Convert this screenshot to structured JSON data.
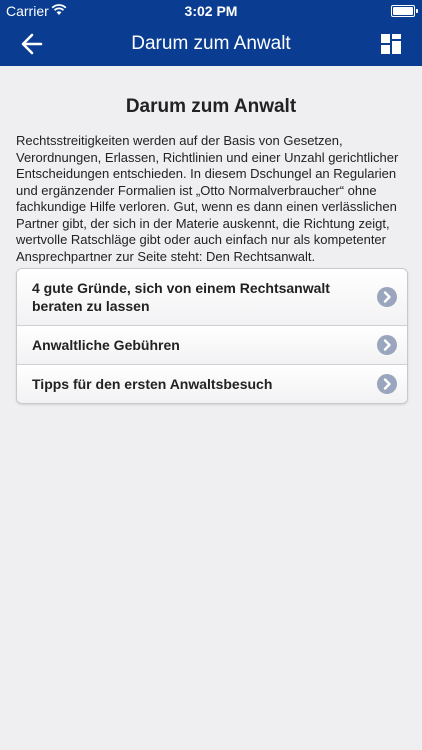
{
  "status": {
    "carrier": "Carrier",
    "time": "3:02 PM"
  },
  "nav": {
    "title": "Darum zum Anwalt"
  },
  "page": {
    "title": "Darum zum Anwalt",
    "intro": "Rechtsstreitigkeiten werden auf der Basis von Gesetzen, Verordnungen, Erlassen, Richtlinien und einer Unzahl gerichtlicher Entscheidungen entschieden. In diesem Dschungel an Regularien und ergänzender Formalien ist „Otto Normalverbraucher“ ohne fachkundige Hilfe verloren. Gut, wenn es dann einen verlässlichen Partner gibt, der sich in der Materie auskennt, die Richtung zeigt, wertvolle Ratschläge gibt oder auch einfach nur als kompetenter Ansprechpartner zur Seite steht: Den Rechtsanwalt."
  },
  "menu": {
    "items": [
      {
        "label": "4 gute Gründe, sich von einem Rechtsanwalt beraten zu lassen"
      },
      {
        "label": "Anwaltliche Gebühren"
      },
      {
        "label": "Tipps für den ersten Anwaltsbesuch"
      }
    ]
  },
  "colors": {
    "header": "#0a3d91",
    "background": "#efeff2",
    "chevron": "#9aa6bd"
  },
  "icons": {
    "back": "arrow-left-icon",
    "menu": "grid-layout-icon",
    "disclosure": "chevron-right-circle-icon"
  }
}
